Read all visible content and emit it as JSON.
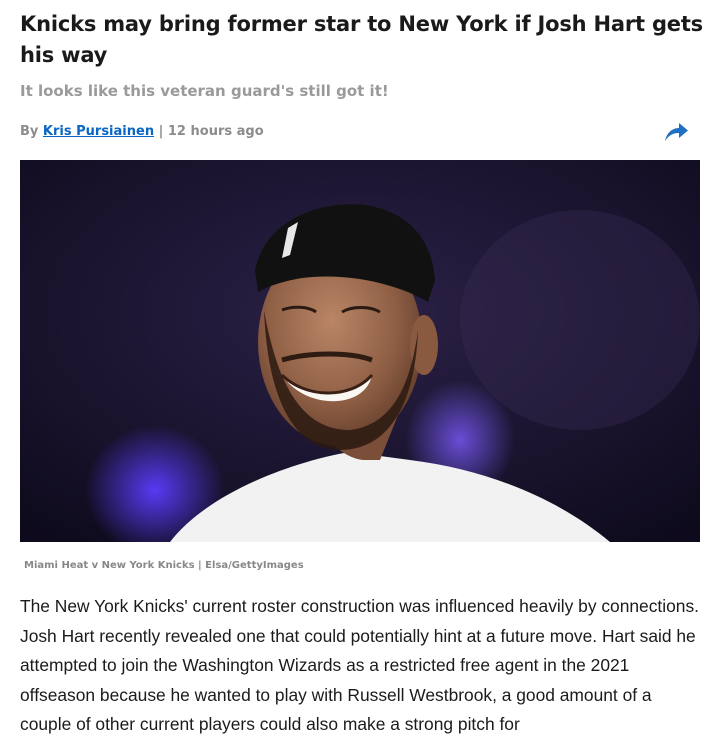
{
  "article": {
    "headline": "Knicks may bring former star to New York if Josh Hart gets his way",
    "subheadline": "It looks like this veteran guard's still got it!",
    "byline": {
      "prefix": "By ",
      "author": "Kris Pursiainen",
      "separator": " | ",
      "time": "12 hours ago"
    },
    "share_icon": "share-arrow-icon",
    "image_caption": "Miami Heat v New York Knicks | Elsa/GettyImages",
    "body": "The New York Knicks' current roster construction was influenced heavily by connections. Josh Hart recently revealed one that could potentially hint at a future move. Hart said he attempted to join the Washington Wizards as a restricted free agent in the 2021 offseason because he wanted to play with Russell Westbrook, a good amount of a couple of other current players could also make a strong pitch for"
  },
  "colors": {
    "link": "#0a66c2",
    "muted": "#9a9a9a",
    "text": "#1b1b1b"
  }
}
